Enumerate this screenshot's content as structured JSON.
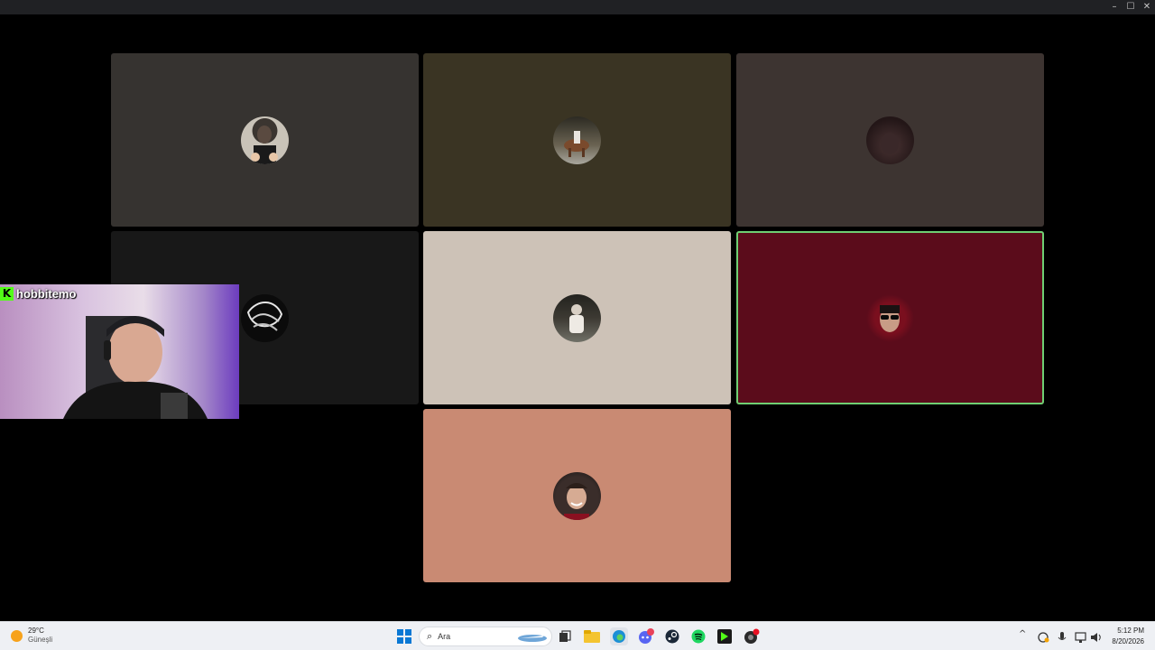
{
  "window": {
    "minimize_glyph": "–",
    "maximize_glyph": "☐",
    "close_glyph": "✕"
  },
  "call": {
    "participants": [
      {
        "id": "p1",
        "tile_color": "#363330",
        "avatar": "man-avatar"
      },
      {
        "id": "p2",
        "tile_color": "#3a3423",
        "avatar": "horse-avatar"
      },
      {
        "id": "p3",
        "tile_color": "#3d3431",
        "avatar": "dark-avatar"
      },
      {
        "id": "p4",
        "tile_color": "#181818",
        "avatar": "drawing-avatar"
      },
      {
        "id": "p5",
        "tile_color": "#cdc2b7",
        "avatar": "sitting-person-avatar"
      },
      {
        "id": "p6",
        "tile_color": "#5b0c1b",
        "avatar": "sunglasses-avatar",
        "speaking": true
      },
      {
        "id": "p7",
        "tile_color": "#c98a73",
        "avatar": "smiling-man-avatar"
      }
    ],
    "speaking_outline_color": "#6fcf73"
  },
  "webcam": {
    "channel_name": "hobbitemo",
    "platform_glyph": "K",
    "platform_color": "#53fc18"
  },
  "taskbar": {
    "weather": {
      "temperature": "29°C",
      "condition": "Güneşli"
    },
    "search_placeholder": "Ara",
    "apps": [
      "windows-start-icon",
      "search-icon",
      "task-view-icon",
      "file-explorer-icon",
      "edge-icon",
      "discord-icon",
      "steam-icon",
      "spotify-icon",
      "terminal-app-icon",
      "recorder-icon"
    ],
    "tray": {
      "chevron": "^"
    },
    "clock": {
      "time": "5:12 PM",
      "date": "8/20/2026"
    }
  }
}
